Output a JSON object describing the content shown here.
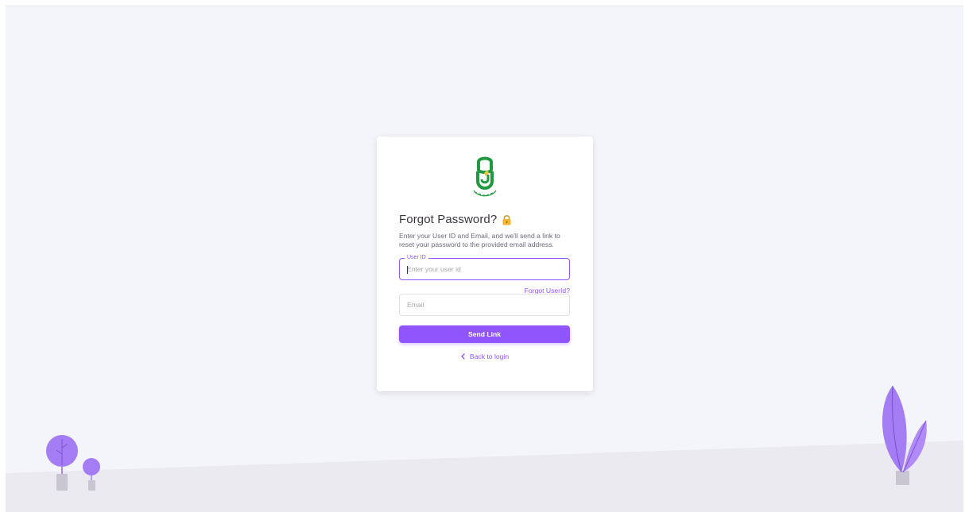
{
  "card": {
    "title": "Forgot Password?",
    "description": "Enter your User ID and Email, and we'll send a link to reset your password to the provided email address.",
    "user_id": {
      "label": "User ID",
      "placeholder": "Enter your user id",
      "value": ""
    },
    "forgot_userid_label": "Forgot UserId?",
    "email": {
      "placeholder": "Email",
      "value": ""
    },
    "send_button_label": "Send Link",
    "back_label": "Back to login"
  },
  "icons": {
    "logo": "organization-logo",
    "title_icon": "lock-icon",
    "back_icon": "chevron-left-icon"
  },
  "colors": {
    "primary": "#9155fd",
    "background": "#f4f5fa",
    "logo_green": "#1f9a3e"
  }
}
